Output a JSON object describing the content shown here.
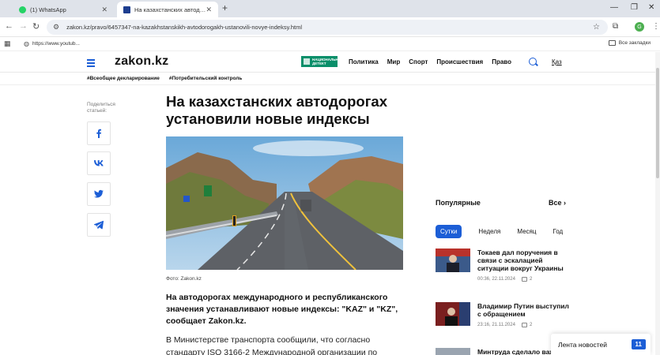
{
  "browser": {
    "tabs": [
      {
        "label": "(1) WhatsApp",
        "favicon_color": "#25d366"
      },
      {
        "label": "На казахстанских автодорогах",
        "favicon_color": "#1c3d8f"
      }
    ],
    "url": "zakon.kz/pravo/6457347-na-kazakhstanskikh-avtodorogakh-ustanovili-novye-indeksy.html",
    "profile_initial": "G",
    "bookmarks": {
      "item": "https://www.youtub...",
      "all": "Все закладки"
    }
  },
  "site": {
    "logo": "zakon.kz",
    "badge": "НАЦИОНАЛЬНЫЙ ДЕТЕКТ",
    "nav": [
      "Политика",
      "Мир",
      "Спорт",
      "Происшествия",
      "Право"
    ],
    "lang": "Қаз",
    "tags": [
      "#Всеобщее декларирование",
      "#Потребительский контроль"
    ]
  },
  "share": {
    "label": "Поделиться статьей:"
  },
  "article": {
    "title": "На казахстанских автодорогах установили новые индексы",
    "caption": "Фото: Zakon.kz",
    "lead": "На автодорогах международного и республиканского значения устанавливают новые индексы: \"KAZ\" и \"KZ\", сообщает Zakon.kz.",
    "body": "В Министерстве транспорта сообщили, что согласно стандарту ISO 3166-2 Международной организации по стандартизации,"
  },
  "sidebar": {
    "popular_title": "Популярные",
    "popular_all": "Все",
    "tabs": [
      "Сутки",
      "Неделя",
      "Месяц",
      "Год"
    ],
    "news": [
      {
        "title": "Токаев дал поручения в связи с эскалацией ситуации вокруг Украины",
        "time": "00:36, 22.11.2024",
        "comments": "2"
      },
      {
        "title": "Владимир Путин выступил с обращением",
        "time": "23:16, 21.11.2024",
        "comments": "2"
      },
      {
        "title": "Минтруда сделало важ",
        "time": "",
        "comments": ""
      }
    ],
    "feed_label": "Лента новостей",
    "feed_count": "11"
  },
  "colors": {
    "accent": "#1c5ed6",
    "badge_green": "#0a8f6a"
  }
}
